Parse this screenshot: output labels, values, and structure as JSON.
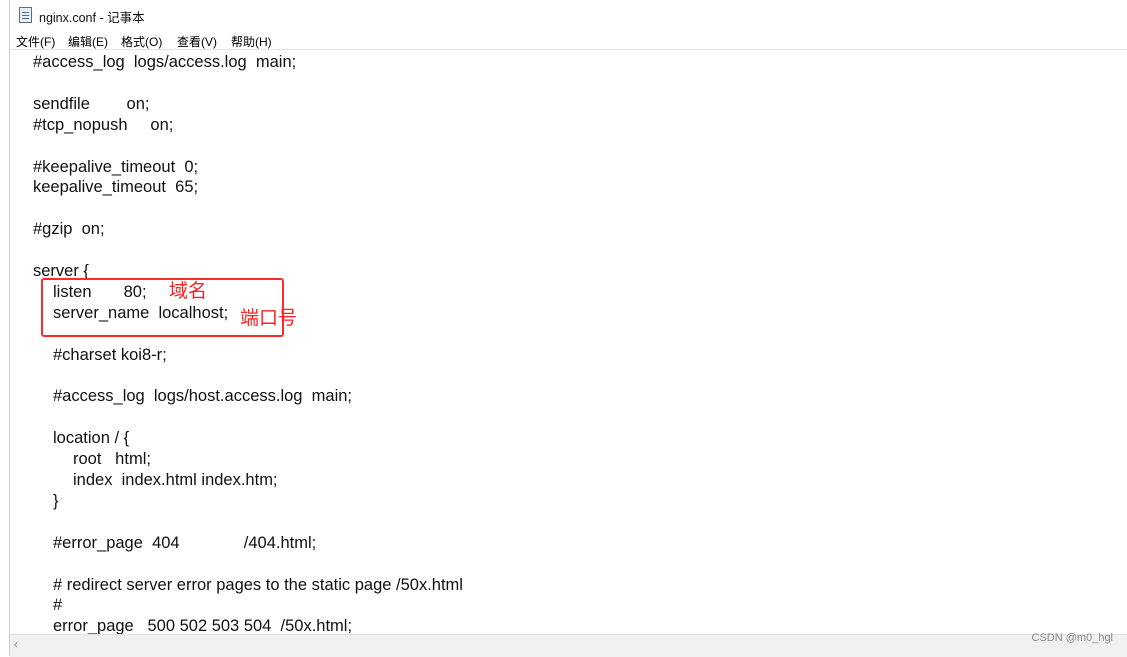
{
  "window": {
    "title": "nginx.conf - 记事本",
    "icon": "notepad-icon"
  },
  "menu": {
    "file": "文件(F)",
    "edit": "编辑(E)",
    "format": "格式(O)",
    "view": "查看(V)",
    "help": "帮助(H)"
  },
  "code": {
    "lines": [
      "#access_log  logs/access.log  main;",
      "",
      "sendfile        on;",
      "#tcp_nopush     on;",
      "",
      "#keepalive_timeout  0;",
      "keepalive_timeout  65;",
      "",
      "#gzip  on;",
      "",
      "server {",
      "    listen       80;",
      "    server_name  localhost;",
      "",
      "    #charset koi8-r;",
      "",
      "    #access_log  logs/host.access.log  main;",
      "",
      "    location / {",
      "        root   html;",
      "        index  index.html index.htm;",
      "    }",
      "",
      "    #error_page  404              /404.html;",
      "",
      "    # redirect server error pages to the static page /50x.html",
      "    #",
      "    error_page   500 502 503 504  /50x.html;"
    ]
  },
  "annotations": {
    "domain_label": "域名",
    "port_label": "端口号",
    "color": "#ff2020"
  },
  "scrollbar": {
    "left_arrow": "‹"
  },
  "watermark": "CSDN @m0_hgl"
}
